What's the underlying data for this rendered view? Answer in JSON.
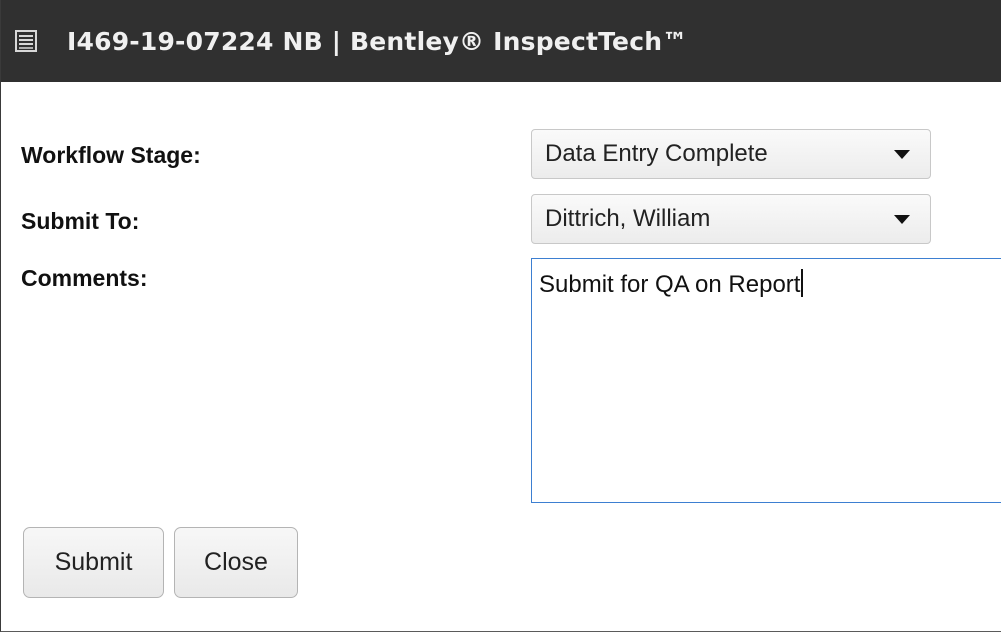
{
  "window": {
    "title": "I469-19-07224 NB | Bentley® InspectTech™",
    "icon": "document-list-icon"
  },
  "form": {
    "workflow_stage": {
      "label": "Workflow Stage:",
      "value": "Data Entry Complete"
    },
    "submit_to": {
      "label": "Submit To:",
      "value": "Dittrich, William"
    },
    "comments": {
      "label": "Comments:",
      "value": "Submit for QA on Report"
    }
  },
  "buttons": {
    "submit": "Submit",
    "close": "Close"
  },
  "colors": {
    "titlebar": "#303030",
    "focus_border": "#3d7fd1"
  }
}
